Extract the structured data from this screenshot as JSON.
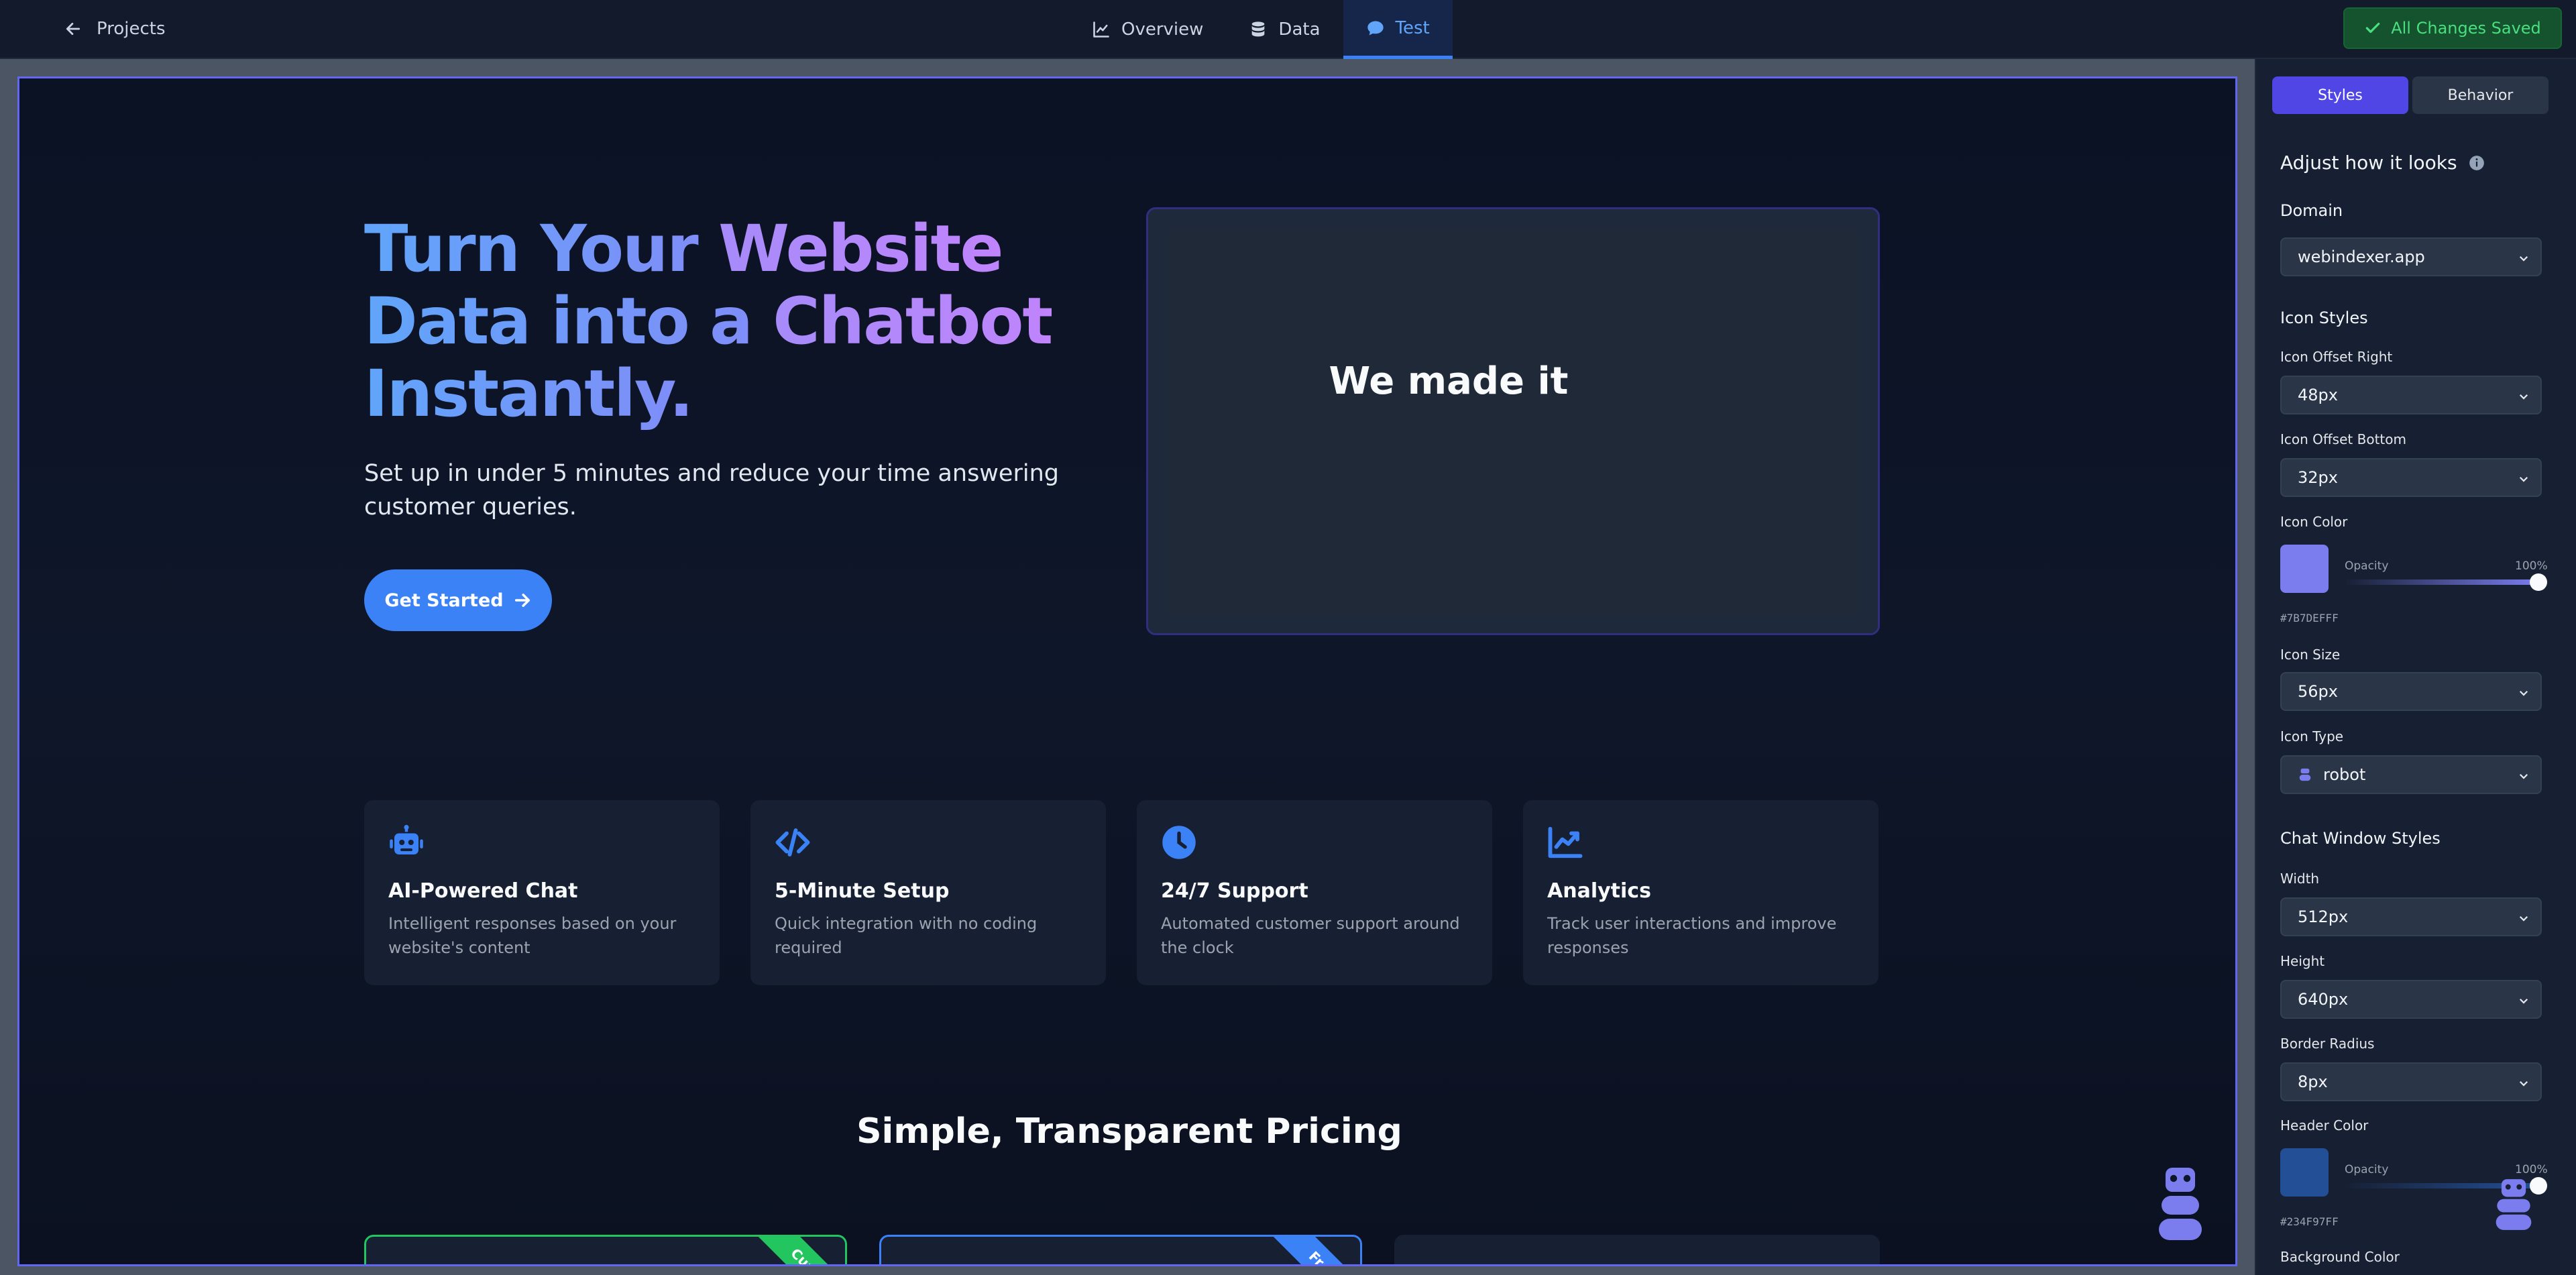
{
  "topbar": {
    "back_label": "Projects",
    "tabs": [
      {
        "label": "Overview",
        "icon": "line-chart-icon",
        "active": false
      },
      {
        "label": "Data",
        "icon": "database-icon",
        "active": false
      },
      {
        "label": "Test",
        "icon": "chat-bubble-icon",
        "active": true
      }
    ],
    "saved_label": "All Changes Saved"
  },
  "preview": {
    "hero": {
      "title_parts": [
        "Turn Your ",
        "Website",
        "Data into a ",
        "Chatbot",
        "Instantly."
      ],
      "subtitle": "Set up in under 5 minutes and reduce your time answering customer queries.",
      "cta_label": "Get Started"
    },
    "demo_text": "We made it",
    "features": [
      {
        "title": "AI-Powered Chat",
        "desc": "Intelligent responses based on your website's content",
        "icon": "robot-icon"
      },
      {
        "title": "5-Minute Setup",
        "desc": "Quick integration with no coding required",
        "icon": "code-icon"
      },
      {
        "title": "24/7 Support",
        "desc": "Automated customer support around the clock",
        "icon": "clock-icon"
      },
      {
        "title": "Analytics",
        "desc": "Track user interactions and improve responses",
        "icon": "trend-chart-icon"
      }
    ],
    "pricing_title": "Simple, Transparent Pricing",
    "ribbons": [
      "Curr",
      "Fre"
    ]
  },
  "panel": {
    "tabs": [
      "Styles",
      "Behavior"
    ],
    "title": "Adjust how it looks",
    "domain_label": "Domain",
    "domain_value": "webindexer.app",
    "icon_section": "Icon Styles",
    "offset_right_label": "Icon Offset Right",
    "offset_right_value": "48px",
    "offset_bottom_label": "Icon Offset Bottom",
    "offset_bottom_value": "32px",
    "icon_color_label": "Icon Color",
    "opacity_label": "Opacity",
    "icon_opacity": "100%",
    "icon_hex": "#7B7DEFFF",
    "icon_size_label": "Icon Size",
    "icon_size_value": "56px",
    "icon_type_label": "Icon Type",
    "icon_type_value": "robot",
    "chat_section": "Chat Window Styles",
    "width_label": "Width",
    "width_value": "512px",
    "height_label": "Height",
    "height_value": "640px",
    "radius_label": "Border Radius",
    "radius_value": "8px",
    "header_color_label": "Header Color",
    "header_opacity": "100%",
    "header_hex": "#234F97FF",
    "bg_color_label": "Background Color"
  },
  "colors": {
    "accent": "#4f46e5",
    "primary_blue": "#3b82f6",
    "icon_color": "#7b7def",
    "header_color": "#234f97",
    "saved_green": "#4ade80"
  }
}
